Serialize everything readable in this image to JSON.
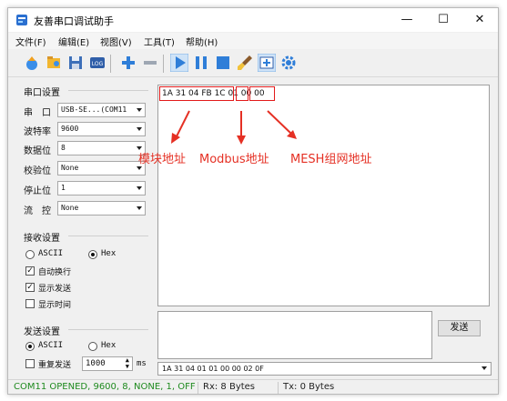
{
  "window": {
    "title": "友善串口调试助手",
    "minimize_icon": "minimize-icon",
    "maximize_icon": "maximize-icon",
    "close_icon": "close-icon"
  },
  "menu": [
    "文件(F)",
    "编辑(E)",
    "视图(V)",
    "工具(T)",
    "帮助(H)"
  ],
  "toolbar_icons": [
    "new-session-icon",
    "open-icon",
    "save-icon",
    "log-icon",
    "plus-icon",
    "minus-icon",
    "play-icon",
    "pause-icon",
    "stop-icon",
    "clear-brush-icon",
    "add-window-icon",
    "settings-gear-icon"
  ],
  "serial_settings": {
    "group_title": "串口设置",
    "port_label": "串　口",
    "port_value": "USB-SE...(COM11",
    "baud_label": "波特率",
    "baud_value": "9600",
    "databits_label": "数据位",
    "databits_value": "8",
    "parity_label": "校验位",
    "parity_value": "None",
    "stopbits_label": "停止位",
    "stopbits_value": "1",
    "flow_label": "流　控",
    "flow_value": "None"
  },
  "receive_settings": {
    "group_title": "接收设置",
    "ascii_label": "ASCII",
    "hex_label": "Hex",
    "auto_wrap_label": "自动换行",
    "show_send_label": "显示发送",
    "show_time_label": "显示时间",
    "ascii_selected": false,
    "hex_selected": true,
    "auto_wrap_checked": true,
    "show_send_checked": true,
    "show_time_checked": false
  },
  "send_settings": {
    "group_title": "发送设置",
    "ascii_label": "ASCII",
    "hex_label": "Hex",
    "ascii_selected": true,
    "hex_selected": false,
    "repeat_label": "重复发送",
    "repeat_checked": false,
    "interval_value": "1000",
    "interval_unit": "ms"
  },
  "receive": {
    "part1": "1A 31 04 FB 1C",
    "part2": "01",
    "part3": "00 00"
  },
  "annotations": {
    "module_address": "模块地址",
    "modbus_address": "Modbus地址",
    "mesh_address": "MESH组网地址"
  },
  "send": {
    "button_label": "发送",
    "history_value": "1A 31 04 01 01 00 00 02 0F"
  },
  "status": {
    "port_status": "COM11 OPENED, 9600, 8, NONE, 1, OFF",
    "rx": "Rx: 8 Bytes",
    "tx": "Tx: 0 Bytes"
  },
  "colors": {
    "accent_blue": "#2f7ed8",
    "status_green": "#1e8a1e",
    "annotation_red": "#e53024"
  }
}
